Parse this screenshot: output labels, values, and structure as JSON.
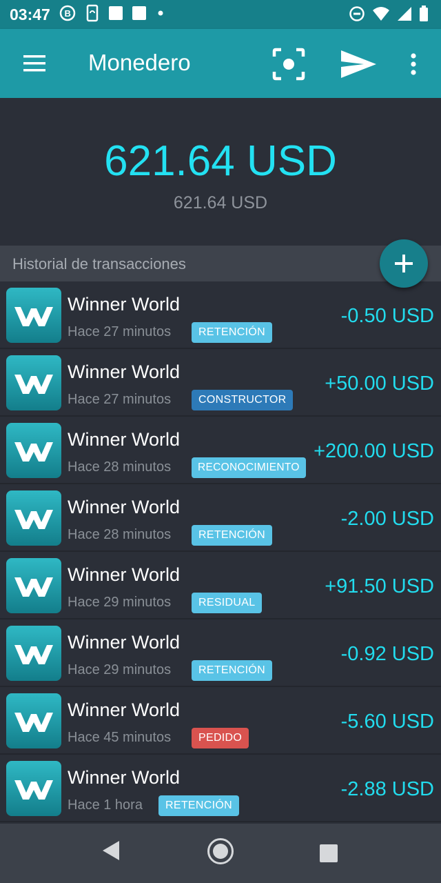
{
  "status_bar": {
    "time": "03:47"
  },
  "app_bar": {
    "title": "Monedero"
  },
  "balance": {
    "main": "621.64 USD",
    "secondary": "621.64 USD"
  },
  "history": {
    "title": "Historial de transacciones"
  },
  "colors": {
    "accent": "#1e9aa6",
    "amount": "#22dcee",
    "badge_retencion": "#59c3e6",
    "badge_constructor": "#2d7ab8",
    "badge_pedido": "#d9534f"
  },
  "transactions": [
    {
      "name": "Winner World",
      "time": "Hace 27 minutos",
      "badge": "RETENCIÓN",
      "amount": "-0.50 USD"
    },
    {
      "name": "Winner World",
      "time": "Hace 27 minutos",
      "badge": "CONSTRUCTOR",
      "amount": "+50.00 USD"
    },
    {
      "name": "Winner World",
      "time": "Hace 28 minutos",
      "badge": "RECONOCIMIENTO",
      "amount": "+200.00 USD"
    },
    {
      "name": "Winner World",
      "time": "Hace 28 minutos",
      "badge": "RETENCIÓN",
      "amount": "-2.00 USD"
    },
    {
      "name": "Winner World",
      "time": "Hace 29 minutos",
      "badge": "RESIDUAL",
      "amount": "+91.50 USD"
    },
    {
      "name": "Winner World",
      "time": "Hace 29 minutos",
      "badge": "RETENCIÓN",
      "amount": "-0.92 USD"
    },
    {
      "name": "Winner World",
      "time": "Hace 45 minutos",
      "badge": "PEDIDO",
      "amount": "-5.60 USD"
    },
    {
      "name": "Winner World",
      "time": "Hace 1 hora",
      "badge": "RETENCIÓN",
      "amount": "-2.88 USD"
    }
  ]
}
